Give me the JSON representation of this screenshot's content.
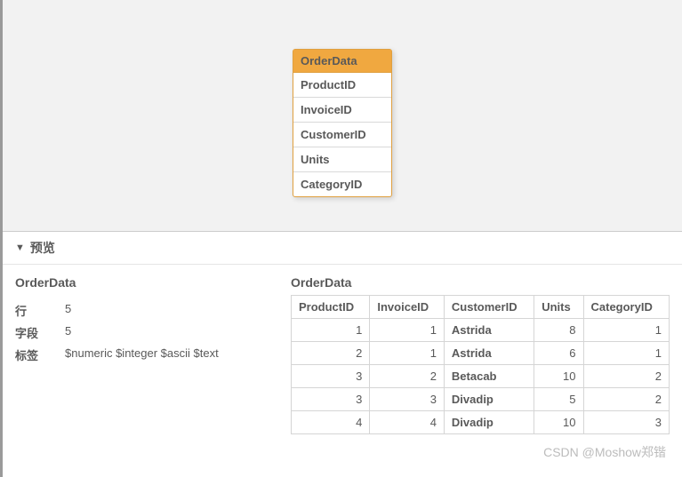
{
  "schema": {
    "name": "OrderData",
    "fields": [
      "ProductID",
      "InvoiceID",
      "CustomerID",
      "Units",
      "CategoryID"
    ]
  },
  "preview": {
    "heading": "预览",
    "meta": {
      "title": "OrderData",
      "rows_label": "行",
      "rows_value": "5",
      "fields_label": "字段",
      "fields_value": "5",
      "tags_label": "标签",
      "tags_value": "$numeric $integer $ascii $text"
    },
    "table": {
      "title": "OrderData",
      "columns": [
        "ProductID",
        "InvoiceID",
        "CustomerID",
        "Units",
        "CategoryID"
      ],
      "column_types": [
        "num",
        "num",
        "txt",
        "num",
        "num"
      ],
      "rows": [
        [
          "1",
          "1",
          "Astrida",
          "8",
          "1"
        ],
        [
          "2",
          "1",
          "Astrida",
          "6",
          "1"
        ],
        [
          "3",
          "2",
          "Betacab",
          "10",
          "2"
        ],
        [
          "3",
          "3",
          "Divadip",
          "5",
          "2"
        ],
        [
          "4",
          "4",
          "Divadip",
          "10",
          "3"
        ]
      ]
    }
  },
  "watermark": "CSDN @Moshow郑锴"
}
